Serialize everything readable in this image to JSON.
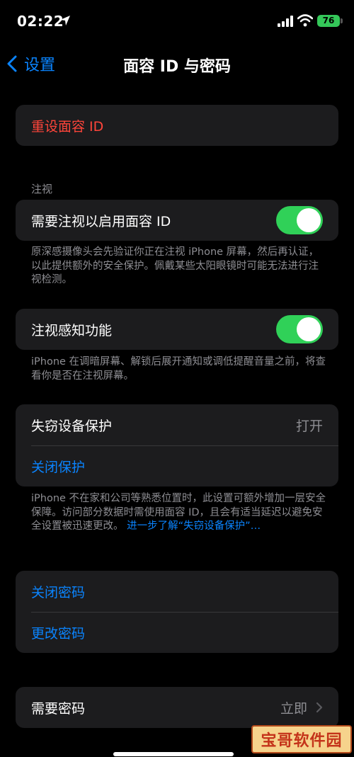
{
  "status": {
    "time": "02:22",
    "battery": "76"
  },
  "nav": {
    "back_label": "设置",
    "title": "面容 ID 与密码"
  },
  "reset": {
    "label": "重设面容 ID"
  },
  "attention": {
    "header": "注视",
    "require_label": "需要注视以启用面容 ID",
    "require_on": true,
    "require_footnote": "原深感摄像头会先验证你正在注视 iPhone 屏幕，然后再认证，以此提供额外的安全保护。佩戴某些太阳眼镜时可能无法进行注视检测。",
    "aware_label": "注视感知功能",
    "aware_on": true,
    "aware_footnote": "iPhone 在调暗屏幕、解锁后展开通知或调低提醒音量之前，将查看你是否在注视屏幕。"
  },
  "theft": {
    "label": "失窃设备保护",
    "value": "打开",
    "turn_off": "关闭保护",
    "footnote": "iPhone 不在家和公司等熟悉位置时，此设置可额外增加一层安全保障。访问部分数据时需使用面容 ID，且会有适当延迟以避免安全设置被迅速更改。",
    "learn_more": "进一步了解“失窃设备保护”…"
  },
  "passcode": {
    "turn_off": "关闭密码",
    "change": "更改密码"
  },
  "require_passcode": {
    "label": "需要密码",
    "value": "立即"
  },
  "watermark": "宝哥软件园",
  "colors": {
    "accent": "#0a84ff",
    "destructive": "#ff453a",
    "toggle_on": "#30d158",
    "background": "#000000",
    "card": "#1c1c1e"
  }
}
